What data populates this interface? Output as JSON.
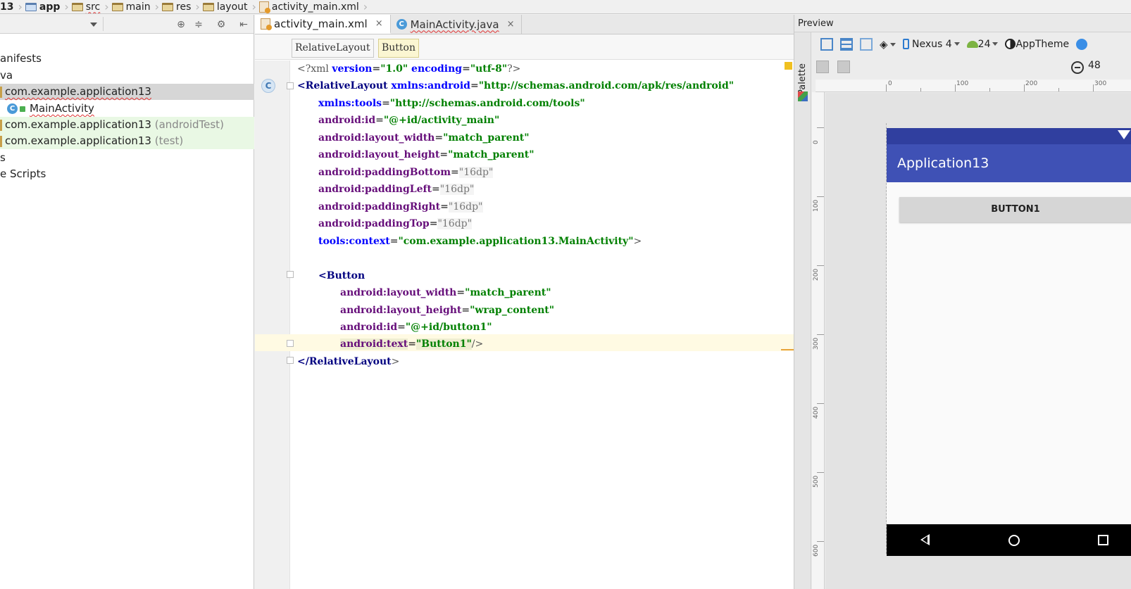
{
  "breadcrumb": {
    "items": [
      "13",
      "app",
      "src",
      "main",
      "res",
      "layout",
      "activity_main.xml"
    ]
  },
  "project": {
    "items": [
      {
        "label": "anifests"
      },
      {
        "label": "va"
      },
      {
        "label": "com.example.application13"
      },
      {
        "label": "MainActivity"
      },
      {
        "label": "com.example.application13",
        "suffix": "(androidTest)"
      },
      {
        "label": "com.example.application13",
        "suffix": "(test)"
      },
      {
        "label": "s"
      },
      {
        "label": "e Scripts"
      }
    ]
  },
  "editor": {
    "tabs": [
      {
        "label": "activity_main.xml",
        "close": "×"
      },
      {
        "label": "MainActivity.java",
        "close": "×"
      }
    ],
    "xml_path": [
      "RelativeLayout",
      "Button"
    ],
    "code": {
      "l1_a": "<?xml ",
      "l1_b": "version",
      "l1_c": "=",
      "l1_d": "\"1.0\"",
      "l1_e": " encoding",
      "l1_f": "=",
      "l1_g": "\"utf-8\"",
      "l1_h": "?>",
      "l2_tag": "<RelativeLayout ",
      "l2_ns": "xmlns:android",
      "l2_eq": "=",
      "l2_val": "\"http://schemas.android.com/apk/res/android\"",
      "l3_ns": "xmlns:tools",
      "l3_eq": "=",
      "l3_val": "\"http://schemas.android.com/tools\"",
      "l4_attr": "android:id",
      "l4_eq": "=",
      "l4_val": "\"@+id/activity_main\"",
      "l5_attr": "android:layout_width",
      "l5_eq": "=",
      "l5_val": "\"match_parent\"",
      "l6_attr": "android:layout_height",
      "l6_eq": "=",
      "l6_val": "\"match_parent\"",
      "l7_attr": "android:paddingBottom",
      "l7_eq": "=",
      "l7_val": "\"16dp\"",
      "l8_attr": "android:paddingLeft",
      "l8_eq": "=",
      "l8_val": "\"16dp\"",
      "l9_attr": "android:paddingRight",
      "l9_eq": "=",
      "l9_val": "\"16dp\"",
      "l10_attr": "android:paddingTop",
      "l10_eq": "=",
      "l10_val": "\"16dp\"",
      "l11_attr": "tools:context",
      "l11_eq": "=",
      "l11_val": "\"com.example.application13.MainActivity\"",
      "l11_end": ">",
      "l13_tag": "<Button",
      "l14_attr": "android:layout_width",
      "l14_eq": "=",
      "l14_val": "\"match_parent\"",
      "l15_attr": "android:layout_height",
      "l15_eq": "=",
      "l15_val": "\"wrap_content\"",
      "l16_attr": "android:id",
      "l16_eq": "=",
      "l16_val": "\"@+id/button1\"",
      "l17_attr": "android:text",
      "l17_eq": "=",
      "l17_val": "\"Button1\"",
      "l17_end": "/>",
      "l18_tag": "</RelativeLayout",
      "l18_end": ">"
    }
  },
  "preview": {
    "title": "Preview",
    "palette_label": "Palette",
    "device": "Nexus 4",
    "api": "24",
    "theme": "AppTheme",
    "zoom": "48",
    "app_title": "Application13",
    "button_text": "BUTTON1",
    "ruler_top": [
      "0",
      "100",
      "200",
      "300"
    ],
    "ruler_left": [
      "0",
      "100",
      "200",
      "300",
      "400",
      "500",
      "600"
    ],
    "colors": {
      "status_bar": "#303f9f",
      "app_bar": "#3f51b5",
      "nav_bar": "#000000"
    }
  }
}
